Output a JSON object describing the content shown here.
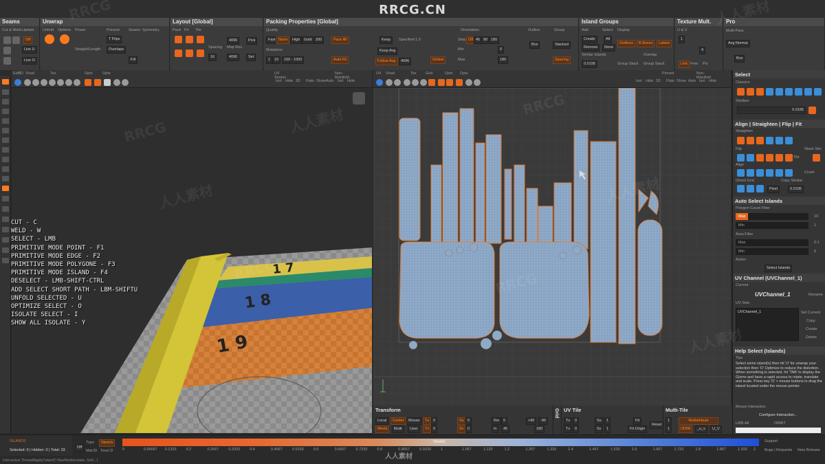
{
  "brand": "RRCG.CN",
  "watermarks": [
    "RRCG",
    "人人素材"
  ],
  "bottom_watermark": "人人素材",
  "top_panels": [
    {
      "title": "Seams",
      "items": [
        "Cut & Weld",
        "Update",
        "Off",
        "Live U",
        "Live O"
      ]
    },
    {
      "title": "Unwrap",
      "items": [
        "Unfold",
        "Options",
        "Power",
        "Prevent",
        "T Flips",
        "Overlaps",
        "Fill",
        "Straight/Length",
        "Seams",
        "Symmetry"
      ]
    },
    {
      "title": "Layout [Global]",
      "items": [
        "Pack",
        "Fit",
        "Tile",
        "Spacing",
        "Map Res",
        "Pick",
        "Set",
        "4096",
        "4096",
        "16"
      ]
    },
    {
      "title": "Packing Properties [Global]",
      "items": [
        "Quality",
        "Fast",
        "Norm",
        "High",
        "Gold",
        "200",
        "Mutations",
        "1",
        "10",
        "100 - 1000",
        "Keep",
        "Keep Avg",
        "Specified 1.0",
        "Follow Avg",
        "4096",
        "Orientation",
        "Step",
        "Off",
        "45",
        "90",
        "180",
        "0",
        "Min",
        "Max",
        "180",
        "Global",
        "Pack All",
        "Auto Fit",
        "Outline",
        "Group",
        "Box",
        "Stacked",
        "Spacing"
      ]
    },
    {
      "title": "Island Groups",
      "items": [
        "Add",
        "Select",
        "Display",
        "Create",
        "All",
        "Remove",
        "None",
        "Outlines",
        "B.Boxes",
        "Labels",
        "Similar Islands",
        "0.0195",
        "Group Stack",
        "Group Stack",
        "Overlap"
      ]
    },
    {
      "title": "Texture Mult.",
      "items": [
        "U & V",
        "1",
        "4",
        "Link",
        "Free",
        "Pix"
      ]
    },
    {
      "title": "Pro",
      "items": [
        "Multi-Pass",
        "Avg Normal",
        "Box"
      ]
    }
  ],
  "uv_header_labels": [
    "UV",
    "Shad",
    "Tex",
    "Grid",
    "Opts",
    "Opts",
    "Isol",
    "Hide",
    "3D",
    "Flats",
    "Show",
    "Auto",
    "Isol",
    "Hide",
    "Pinned",
    "Non-Manifold"
  ],
  "left_header_labels": [
    "Edit",
    "3D",
    "Shad",
    "Tex",
    "Opts",
    "Opts",
    "Isol",
    "Hide",
    "3D",
    "Flats",
    "Show",
    "Auto",
    "Isol",
    "Hide",
    "UV Seams",
    "Non-Manifold"
  ],
  "shortcuts": [
    "CUT - C",
    "WELD - W",
    "SELECT - LMB",
    "PRIMITIVE MODE POINT - F1",
    "PRIMITIVE MODE EDGE - F2",
    "PRIMITIVE MODE POLYGONE - F3",
    "PRIMITIVE MODE ISLAND - F4",
    "DESELECT - LMB-SHIFT-CTRL",
    "ADD SELECT SHORT PATH - LBM-SHIFTU",
    "UNFOLD SELECTED - U",
    "OPTIMIZE SELECT - O",
    "ISOLATE SELECT - I",
    "SHOW ALL ISOLATE - Y"
  ],
  "ruler_numbers": [
    "1 9",
    "1 8",
    "1 7"
  ],
  "right_panel": {
    "select": {
      "title": "Select",
      "sub": [
        "Classics",
        "Similars",
        "0.0195"
      ]
    },
    "align": {
      "title": "Align | Straighten | Flip | Fit",
      "sub": [
        "Straighten",
        "Flip",
        "Stack Sim",
        "Tile",
        "Align",
        "Crush",
        "Orient Grid",
        "Copy Similar",
        "Pixel",
        "0.0195"
      ]
    },
    "auto_select": {
      "title": "Auto Select Islands",
      "sub": [
        "Polygon Count Filter",
        "Max",
        "10",
        "Min",
        "1",
        "Area Filter",
        "Max",
        "0.1",
        "Min",
        "0",
        "Action",
        "Select Islands"
      ]
    },
    "uv_channel": {
      "title": "UV Channel (UVChannel_1)",
      "current": "Current",
      "name": "UVChannel_1",
      "rename": "Rename",
      "uv_sets": "UV Sets",
      "item": "UVChannel_1",
      "actions": [
        "Set Current",
        "Copy",
        "Create",
        "Delete"
      ]
    },
    "help": {
      "title": "Help Select (Islands)",
      "tips_label": "Tips",
      "text": "Select some island(s) then hit 'U' for unwrap your selection then 'O' Optimize to reduce the distortion. When something is selected, hit 'TAB' to display the Gizmo and have a rapid access to rotate, translate and scale. Press key 'D' + mouse buttons to drag the island located under the mouse pointer.",
      "mouse_label": "Mouse Interaction",
      "configure": "Configure Interaction...",
      "lmb": "LMB-All",
      "orbit": "ORBIT"
    }
  },
  "bottom_panels": {
    "transform": {
      "title": "Transform",
      "items": [
        "Local",
        "Center",
        "Mouse",
        "Tu",
        "0",
        "Su",
        "0",
        "Rw",
        "0",
        "+90",
        "-90",
        "World",
        "Multi",
        "User",
        "Tv",
        "0",
        "Sv",
        "0",
        "In",
        "45",
        "180"
      ]
    },
    "grid": "Grid",
    "uv_tile": {
      "title": "UV Tile",
      "items": [
        "Tu",
        "0",
        "Su",
        "1",
        "Fit",
        "Tv",
        "0",
        "Sv",
        "1",
        "Fit Origin",
        "Reset"
      ]
    },
    "multi_tile": {
      "title": "Multi-Tile",
      "items": [
        "1",
        "1",
        "Redistribute",
        "UDIM",
        "_u_v",
        "U_V"
      ]
    }
  },
  "status": {
    "mode": "ISLANDS",
    "counts": "Selected: 0 | Hidden: 0 | Total: 33",
    "off": "Off",
    "topo": "Topo",
    "stretch": "Stretch",
    "mat_id": "Mat ID",
    "texel_d": "Texel D",
    "center_label": "Stretch",
    "ticks": [
      "0",
      "0.06667",
      "0.1333",
      "0.2",
      "0.2667",
      "0.3333",
      "0.4",
      "0.4667",
      "0.5333",
      "0.6",
      "0.6667",
      "0.7333",
      "0.8",
      "0.8667",
      "0.9333",
      "1",
      "1.067",
      "1.133",
      "1.2",
      "1.267",
      "1.333",
      "1.4",
      "1.467",
      "1.533",
      "1.6",
      "1.667",
      "1.733",
      "1.8",
      "1.867",
      "1.933",
      "2"
    ],
    "support": "Support",
    "links": "Bugs | Requests",
    "new_release": "New Release",
    "log": "Interactive ThreadApply('island') NavMode(rotate, SetI...)"
  },
  "colors": {
    "accent": "#ff7a1c",
    "island_fill": "#8ca8c8",
    "island_outline": "#e07a30",
    "uv_bg": "#3a3a3a"
  }
}
